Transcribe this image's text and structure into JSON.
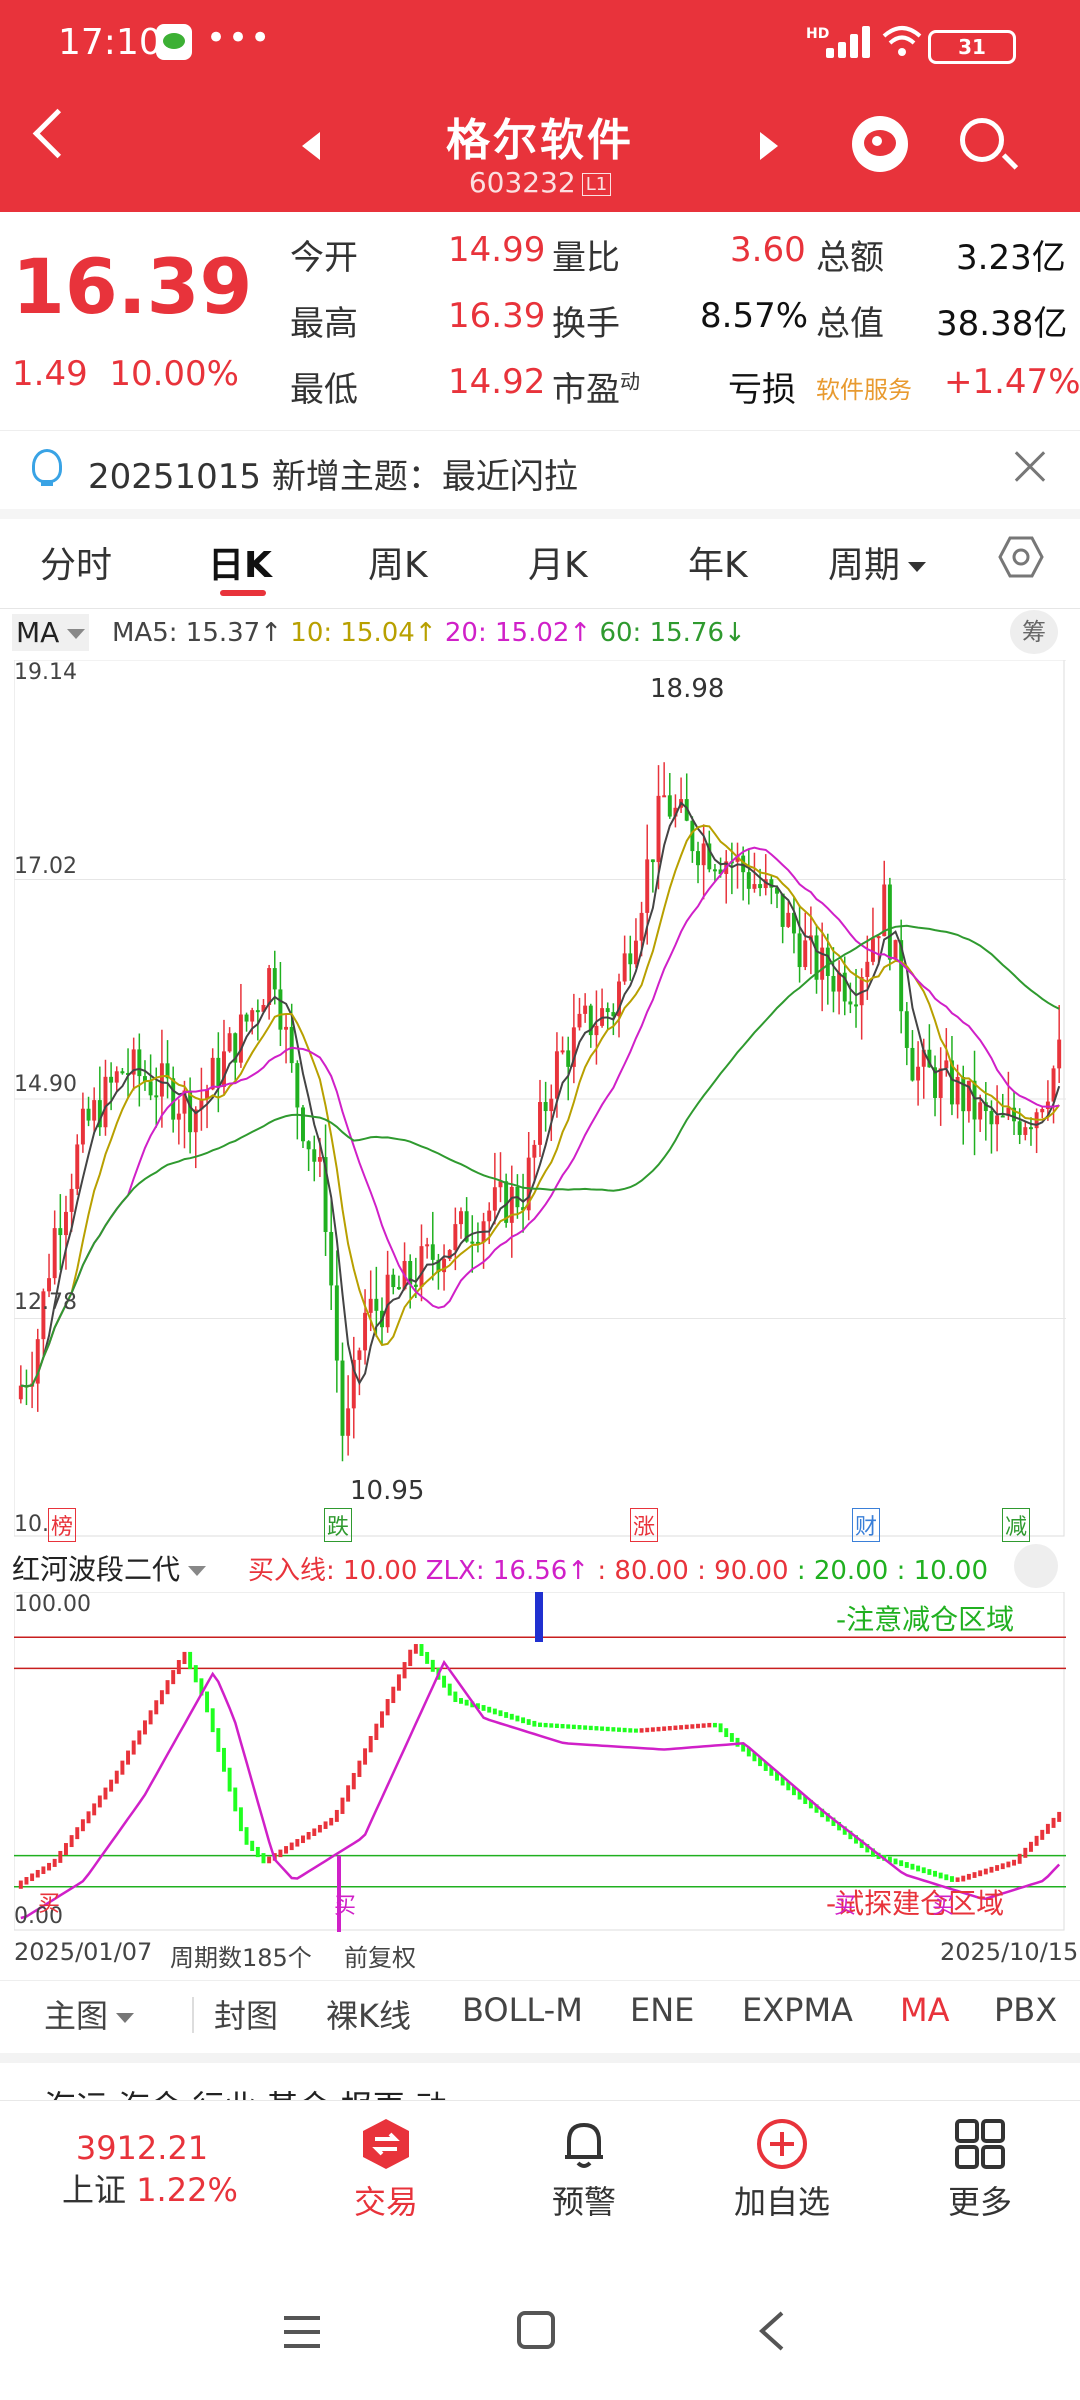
{
  "status": {
    "time": "17:10",
    "dots": "•••",
    "hd": "HD",
    "battery": "31"
  },
  "header": {
    "title": "格尔软件",
    "code": "603232",
    "code_tag": "L1"
  },
  "quote": {
    "price": "16.39",
    "change": "1.49",
    "change_pct": "10.00%",
    "open_label": "今开",
    "open": "14.99",
    "high_label": "最高",
    "high": "16.39",
    "low_label": "最低",
    "low": "14.92",
    "vol_ratio_label": "量比",
    "vol_ratio": "3.60",
    "turnover_label": "换手",
    "turnover": "8.57%",
    "pe_label": "市盈",
    "pe_sup": "动",
    "pe": "亏损",
    "amount_label": "总额",
    "amount": "3.23亿",
    "mktcap_label": "总值",
    "mktcap": "38.38亿",
    "sector_tag": "软件服务",
    "sector_chg": "+1.47%"
  },
  "notice": {
    "text": "20251015 新增主题：最近闪拉"
  },
  "tabs": [
    "分时",
    "日K",
    "周K",
    "月K",
    "年K",
    "周期"
  ],
  "ma": {
    "selector": "MA",
    "ma5": "MA5: 15.37↑",
    "ma10": "10: 15.04↑",
    "ma20": "20: 15.02↑",
    "ma60": "60: 15.76↓",
    "button": "筹"
  },
  "chart": {
    "y_top": "19.14",
    "y_2": "17.02",
    "y_3": "14.90",
    "y_4": "12.78",
    "y_bottom": "10.",
    "high_label": "18.98",
    "low_label": "10.95",
    "events": [
      "榜",
      "跌",
      "涨",
      "财",
      "减"
    ]
  },
  "chart_data": {
    "type": "candlestick",
    "ylim": [
      10.66,
      19.14
    ],
    "ticks": [
      19.14,
      17.02,
      14.9,
      12.78
    ],
    "annotations": [
      {
        "text": "18.98",
        "y": 18.98
      },
      {
        "text": "10.95",
        "y": 10.95
      }
    ],
    "ma_colors": {
      "ma5": "#444444",
      "ma10": "#b8a000",
      "ma20": "#d020c8",
      "ma60": "#2f9a2f"
    }
  },
  "indicator": {
    "selector": "红河波段二代",
    "buy_line": "买入线: 10.00",
    "zlx": "ZLX: 16.56↑",
    "l80": ": 80.00",
    "l90": ": 90.00",
    "l20": ": 20.00",
    "l10": ": 10.00",
    "y_top": "100.00",
    "y_bottom": "0.00",
    "zone_top": "-注意减仓区域",
    "zone_bottom": "-试探建仓区域",
    "buy_marks": [
      "买",
      "买",
      "买",
      "买"
    ]
  },
  "datebar": {
    "start": "2025/01/07",
    "period": "周期数185个",
    "adj": "前复权",
    "end": "2025/10/15"
  },
  "ind_tabs": [
    "主图",
    "封图",
    "裸K线",
    "BOLL-M",
    "ENE",
    "EXPMA",
    "MA",
    "PBX"
  ],
  "peek": "海运     海金                         行业         基金         报更       动",
  "bottomnav": {
    "index_value": "3912.21",
    "index_name": "上证",
    "index_pct": "1.22%",
    "trade": "交易",
    "alert": "预警",
    "add": "加自选",
    "more": "更多"
  },
  "colors": {
    "brand_red": "#e8333b",
    "up": "#e8333b",
    "down": "#20b020"
  }
}
